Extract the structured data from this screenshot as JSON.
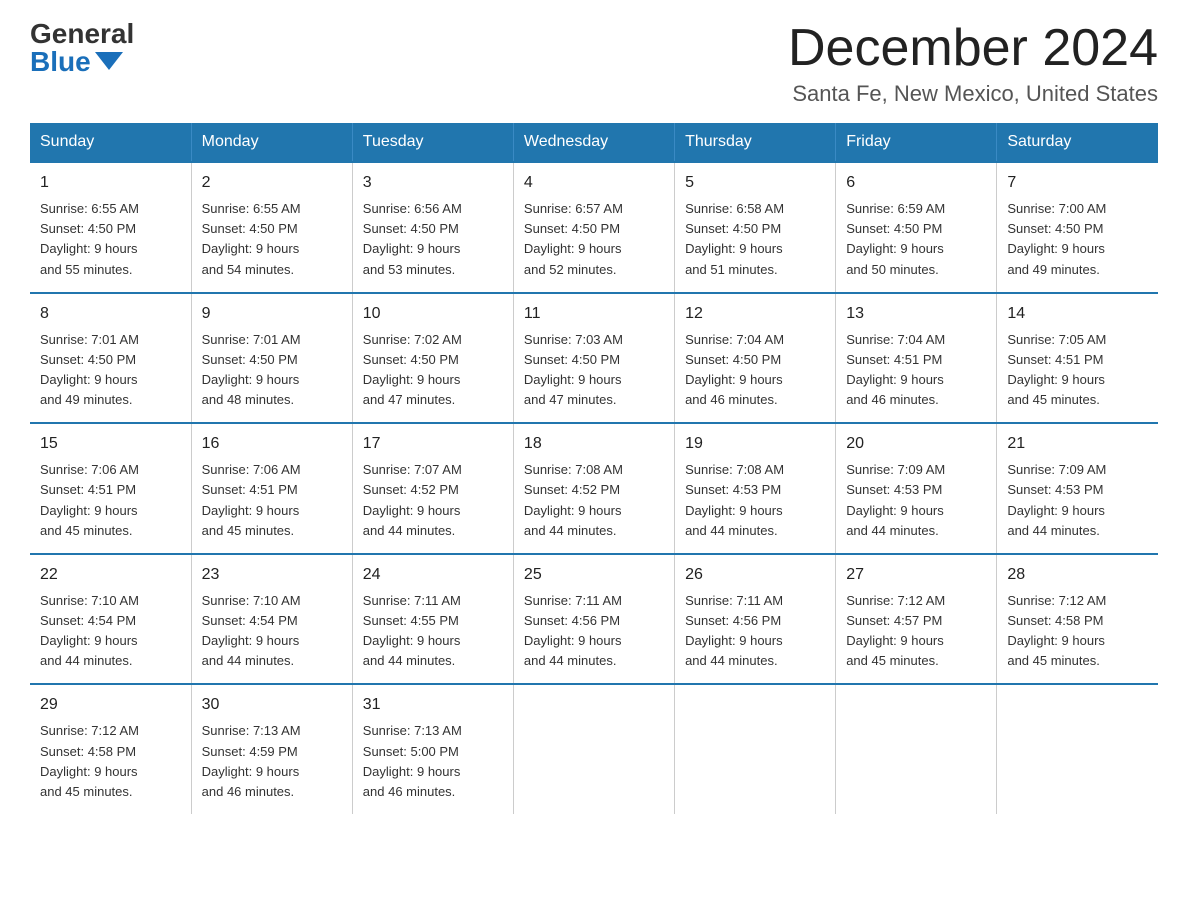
{
  "logo": {
    "general": "General",
    "blue": "Blue"
  },
  "title": "December 2024",
  "location": "Santa Fe, New Mexico, United States",
  "headers": [
    "Sunday",
    "Monday",
    "Tuesday",
    "Wednesday",
    "Thursday",
    "Friday",
    "Saturday"
  ],
  "weeks": [
    [
      {
        "day": "1",
        "info": "Sunrise: 6:55 AM\nSunset: 4:50 PM\nDaylight: 9 hours\nand 55 minutes."
      },
      {
        "day": "2",
        "info": "Sunrise: 6:55 AM\nSunset: 4:50 PM\nDaylight: 9 hours\nand 54 minutes."
      },
      {
        "day": "3",
        "info": "Sunrise: 6:56 AM\nSunset: 4:50 PM\nDaylight: 9 hours\nand 53 minutes."
      },
      {
        "day": "4",
        "info": "Sunrise: 6:57 AM\nSunset: 4:50 PM\nDaylight: 9 hours\nand 52 minutes."
      },
      {
        "day": "5",
        "info": "Sunrise: 6:58 AM\nSunset: 4:50 PM\nDaylight: 9 hours\nand 51 minutes."
      },
      {
        "day": "6",
        "info": "Sunrise: 6:59 AM\nSunset: 4:50 PM\nDaylight: 9 hours\nand 50 minutes."
      },
      {
        "day": "7",
        "info": "Sunrise: 7:00 AM\nSunset: 4:50 PM\nDaylight: 9 hours\nand 49 minutes."
      }
    ],
    [
      {
        "day": "8",
        "info": "Sunrise: 7:01 AM\nSunset: 4:50 PM\nDaylight: 9 hours\nand 49 minutes."
      },
      {
        "day": "9",
        "info": "Sunrise: 7:01 AM\nSunset: 4:50 PM\nDaylight: 9 hours\nand 48 minutes."
      },
      {
        "day": "10",
        "info": "Sunrise: 7:02 AM\nSunset: 4:50 PM\nDaylight: 9 hours\nand 47 minutes."
      },
      {
        "day": "11",
        "info": "Sunrise: 7:03 AM\nSunset: 4:50 PM\nDaylight: 9 hours\nand 47 minutes."
      },
      {
        "day": "12",
        "info": "Sunrise: 7:04 AM\nSunset: 4:50 PM\nDaylight: 9 hours\nand 46 minutes."
      },
      {
        "day": "13",
        "info": "Sunrise: 7:04 AM\nSunset: 4:51 PM\nDaylight: 9 hours\nand 46 minutes."
      },
      {
        "day": "14",
        "info": "Sunrise: 7:05 AM\nSunset: 4:51 PM\nDaylight: 9 hours\nand 45 minutes."
      }
    ],
    [
      {
        "day": "15",
        "info": "Sunrise: 7:06 AM\nSunset: 4:51 PM\nDaylight: 9 hours\nand 45 minutes."
      },
      {
        "day": "16",
        "info": "Sunrise: 7:06 AM\nSunset: 4:51 PM\nDaylight: 9 hours\nand 45 minutes."
      },
      {
        "day": "17",
        "info": "Sunrise: 7:07 AM\nSunset: 4:52 PM\nDaylight: 9 hours\nand 44 minutes."
      },
      {
        "day": "18",
        "info": "Sunrise: 7:08 AM\nSunset: 4:52 PM\nDaylight: 9 hours\nand 44 minutes."
      },
      {
        "day": "19",
        "info": "Sunrise: 7:08 AM\nSunset: 4:53 PM\nDaylight: 9 hours\nand 44 minutes."
      },
      {
        "day": "20",
        "info": "Sunrise: 7:09 AM\nSunset: 4:53 PM\nDaylight: 9 hours\nand 44 minutes."
      },
      {
        "day": "21",
        "info": "Sunrise: 7:09 AM\nSunset: 4:53 PM\nDaylight: 9 hours\nand 44 minutes."
      }
    ],
    [
      {
        "day": "22",
        "info": "Sunrise: 7:10 AM\nSunset: 4:54 PM\nDaylight: 9 hours\nand 44 minutes."
      },
      {
        "day": "23",
        "info": "Sunrise: 7:10 AM\nSunset: 4:54 PM\nDaylight: 9 hours\nand 44 minutes."
      },
      {
        "day": "24",
        "info": "Sunrise: 7:11 AM\nSunset: 4:55 PM\nDaylight: 9 hours\nand 44 minutes."
      },
      {
        "day": "25",
        "info": "Sunrise: 7:11 AM\nSunset: 4:56 PM\nDaylight: 9 hours\nand 44 minutes."
      },
      {
        "day": "26",
        "info": "Sunrise: 7:11 AM\nSunset: 4:56 PM\nDaylight: 9 hours\nand 44 minutes."
      },
      {
        "day": "27",
        "info": "Sunrise: 7:12 AM\nSunset: 4:57 PM\nDaylight: 9 hours\nand 45 minutes."
      },
      {
        "day": "28",
        "info": "Sunrise: 7:12 AM\nSunset: 4:58 PM\nDaylight: 9 hours\nand 45 minutes."
      }
    ],
    [
      {
        "day": "29",
        "info": "Sunrise: 7:12 AM\nSunset: 4:58 PM\nDaylight: 9 hours\nand 45 minutes."
      },
      {
        "day": "30",
        "info": "Sunrise: 7:13 AM\nSunset: 4:59 PM\nDaylight: 9 hours\nand 46 minutes."
      },
      {
        "day": "31",
        "info": "Sunrise: 7:13 AM\nSunset: 5:00 PM\nDaylight: 9 hours\nand 46 minutes."
      },
      {
        "day": "",
        "info": ""
      },
      {
        "day": "",
        "info": ""
      },
      {
        "day": "",
        "info": ""
      },
      {
        "day": "",
        "info": ""
      }
    ]
  ]
}
